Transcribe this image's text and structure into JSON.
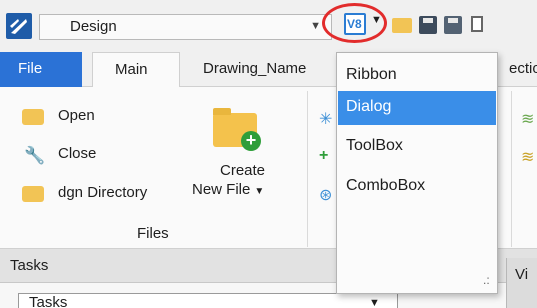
{
  "quick_access": {
    "workflow_value": "Design",
    "ui_mode_button": "V8",
    "icons": [
      "open-folder-icon",
      "save-icon",
      "save-settings-icon",
      "copy-icon"
    ]
  },
  "tabs": {
    "file": "File",
    "main": "Main",
    "drawing": "Drawing_Name",
    "partial_right": "ectio"
  },
  "ribbon": {
    "open": "Open",
    "close": "Close",
    "dgn_directory": "dgn Directory",
    "create_line1": "Create",
    "create_line2": "New File",
    "group_files": "Files"
  },
  "menu": {
    "items": [
      "Ribbon",
      "Dialog",
      "ToolBox",
      "ComboBox"
    ],
    "selected": "Dialog"
  },
  "tasks": {
    "header": "Tasks",
    "combo_value": "Tasks",
    "view_tab": "Vi"
  },
  "colors": {
    "accent": "#2b72d6",
    "menu_selected": "#3a8ee8",
    "highlight_ring": "#e22c2c",
    "folder": "#f2c455",
    "plus_green": "#2f9e3a"
  }
}
